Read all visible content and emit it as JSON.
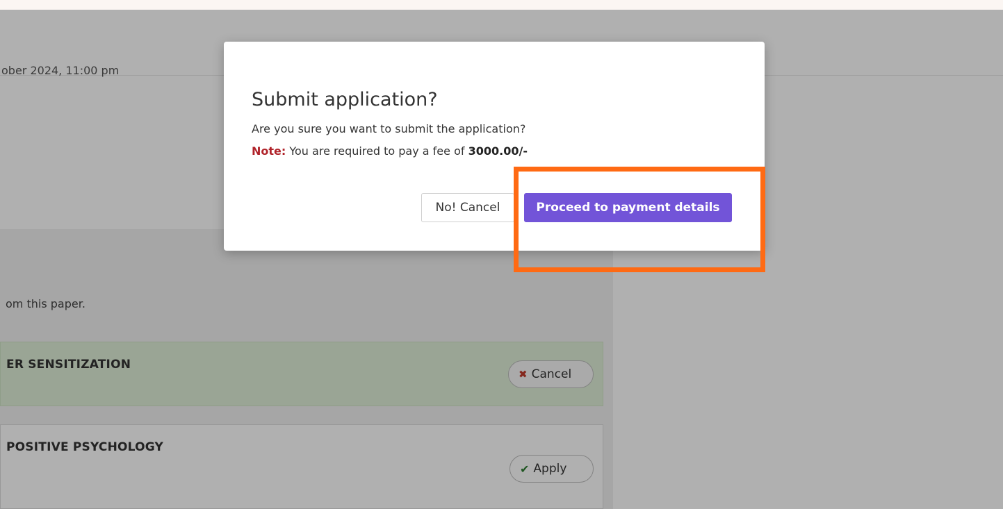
{
  "background": {
    "deadline_fragment": "ober 2024, 11:00 pm",
    "panel_note_fragment": "om this paper.",
    "rows": [
      {
        "title": "ER SENSITIZATION",
        "action_label": "Cancel",
        "action_icon": "x-icon",
        "state": "selected"
      },
      {
        "title": "POSITIVE PSYCHOLOGY",
        "action_label": "Apply",
        "action_icon": "check-icon",
        "state": "normal"
      }
    ]
  },
  "modal": {
    "title": "Submit application?",
    "message": "Are you sure you want to submit the application?",
    "note_label": "Note:",
    "note_text": " You are required to pay a fee of ",
    "fee_amount": "3000.00/-",
    "cancel_label": "No! Cancel",
    "proceed_label": "Proceed to payment details"
  },
  "colors": {
    "accent": "#7254d8",
    "note": "#b0232a",
    "highlight": "#ff6a13",
    "selected_row": "#dff0d8"
  }
}
